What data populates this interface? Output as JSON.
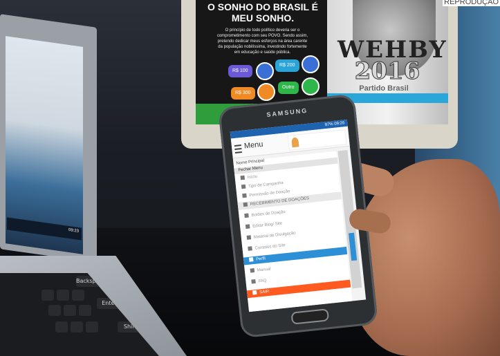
{
  "credit": "REPRODUÇÃO",
  "tablet": {
    "headline": "O SONHO DO BRASIL É MEU SONHO.",
    "paragraph": "O princípio de todo político deveria ser o comprometimento com seu POVO. Sendo assim, pretendo dedicar meus esforços na área carente da população nobilíssima, investindo fortemente em educação e saúde pública.",
    "donations": [
      {
        "label": "R$ 100",
        "color": "#6b59d6",
        "circle": "#3b6fd6"
      },
      {
        "label": "R$ 200",
        "color": "#2aa3d8",
        "circle": "#3b6fd6"
      },
      {
        "label": "R$ 300",
        "color": "#f08a24",
        "circle": "#f08a24"
      },
      {
        "label": "Outro",
        "color": "#2fb64a",
        "circle": "#2fb64a"
      }
    ],
    "candidate_name": "WEHBY",
    "year": "2016",
    "party": "Partido Brasil"
  },
  "phone": {
    "brand": "SAMSUNG",
    "status_text": "97% 09:26",
    "menu_label": "Menu",
    "drawer_name": "Nome Principal",
    "close_menu": "Fechar Menu",
    "items": [
      {
        "label": "Início",
        "icon": "home-icon",
        "style": "normal"
      },
      {
        "label": "Tipo de Campanha",
        "icon": "grid-icon",
        "style": "normal"
      },
      {
        "label": "Permissão de Doação",
        "icon": "mail-icon",
        "style": "normal"
      },
      {
        "label": "RECEBIMENTO DE DOAÇÕES",
        "icon": "card-icon",
        "style": "highlight"
      },
      {
        "label": "Botões de Doação",
        "icon": "grid-icon",
        "style": "normal"
      },
      {
        "label": "Editar Blog/ Site",
        "icon": "file-icon",
        "style": "normal"
      },
      {
        "label": "Material de Divulgação",
        "icon": "file-icon",
        "style": "normal"
      },
      {
        "label": "Contatos do Site",
        "icon": "mail-icon",
        "style": "normal"
      },
      {
        "label": "Perfil",
        "icon": "edit-icon",
        "style": "blue"
      },
      {
        "label": "Manual",
        "icon": "edit-icon",
        "style": "normal"
      },
      {
        "label": "FAQ",
        "icon": "edit-icon",
        "style": "normal"
      },
      {
        "label": "SAIR",
        "icon": "exit-icon",
        "style": "orange"
      }
    ]
  },
  "laptop": {
    "taskbar_time": "09:23",
    "keys": [
      "Backspace",
      "Enter",
      "Shift"
    ]
  },
  "colors": {
    "phone_blue": "#2d8fd6",
    "phone_orange": "#ff5a1f",
    "tablet_green": "#2f9d3b"
  }
}
